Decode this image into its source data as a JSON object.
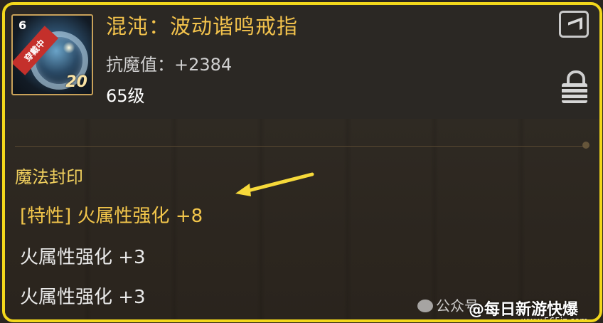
{
  "item": {
    "name": "混沌：波动谐鸣戒指",
    "stat": "抗魔值：+2384",
    "level": "65级",
    "icon": {
      "top_left": "6",
      "ribbon": "穿戴中",
      "badge": "20"
    }
  },
  "seal": {
    "title": "魔法封印",
    "lines": [
      "[特性] 火属性强化 +8",
      "火属性强化 +3",
      "火属性强化 +3"
    ]
  },
  "watermark": {
    "left": "公众号",
    "right": "@每日新游快爆",
    "url": "www.565jz.com"
  },
  "colors": {
    "border": "#f2d71c",
    "name": "#f2c24c",
    "arrow": "#f6d93a"
  },
  "icons": {
    "share": "share-icon",
    "lock": "lock-icon"
  }
}
